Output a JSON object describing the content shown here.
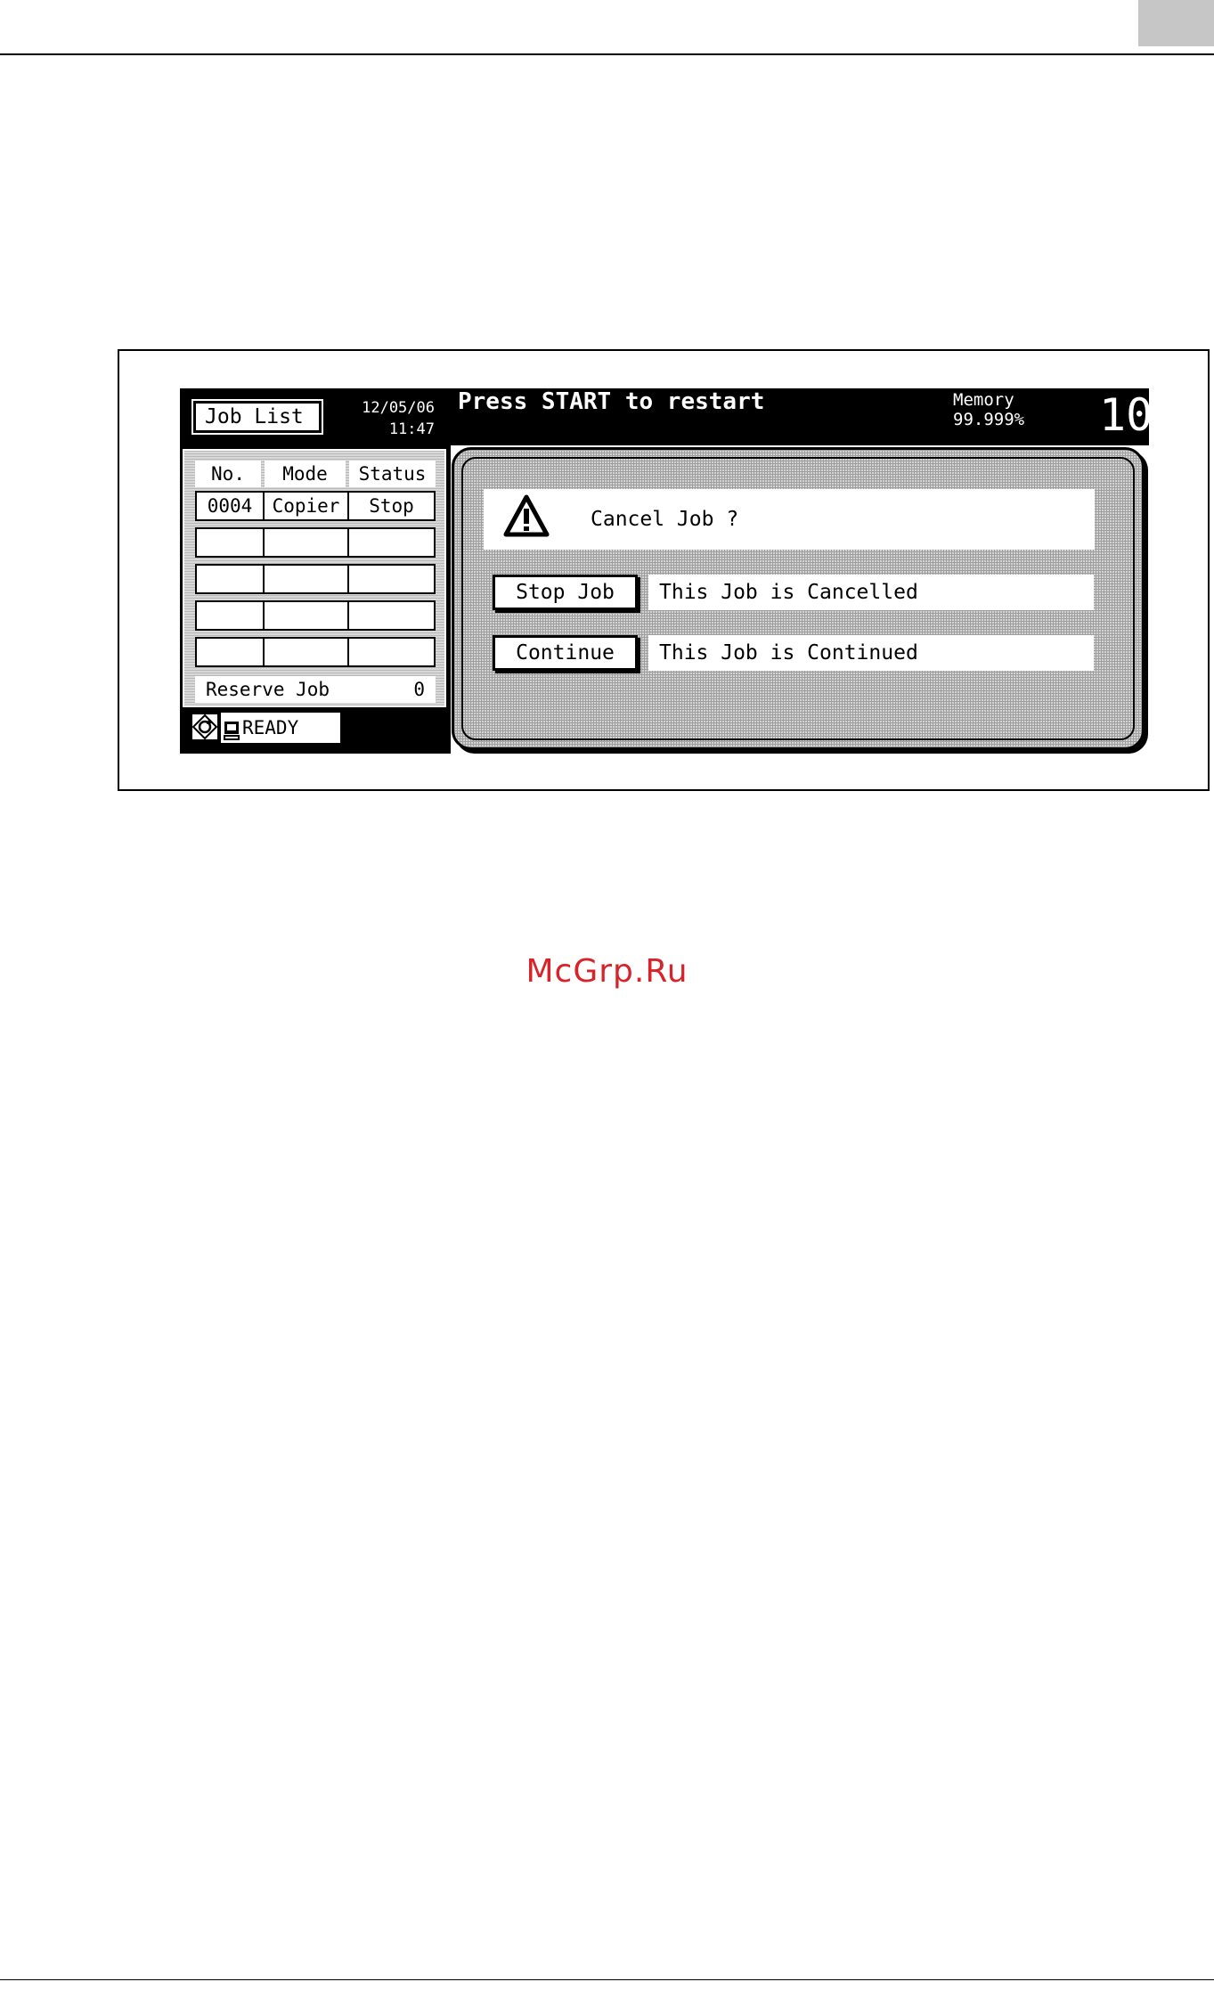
{
  "header": {
    "job_list_button": "Job List",
    "date": "12/05/06",
    "time": "11:47",
    "message": "Press START to restart",
    "memory_label": "Memory",
    "memory_value": "99.999%",
    "counter": "10"
  },
  "job_list": {
    "columns": [
      "No.",
      "Mode",
      "Status"
    ],
    "rows": [
      [
        "0004",
        "Copier",
        "Stop"
      ],
      [
        "",
        "",
        ""
      ],
      [
        "",
        "",
        ""
      ],
      [
        "",
        "",
        ""
      ],
      [
        "",
        "",
        ""
      ]
    ],
    "reserve_label": "Reserve Job",
    "reserve_count": "0"
  },
  "status": {
    "ready_text": "READY",
    "icons": [
      "network-status-icon",
      "device-icon"
    ]
  },
  "dialog": {
    "icon": "warning-icon",
    "prompt": "Cancel Job ?",
    "stop_button": "Stop Job",
    "stop_description": "This Job is Cancelled",
    "continue_button": "Continue",
    "continue_description": "This Job is Continued"
  },
  "watermark": "McGrp.Ru",
  "colors": {
    "screen_bg": "#000000",
    "watermark": "#d8232a",
    "corner_box": "#c6c6c6"
  }
}
